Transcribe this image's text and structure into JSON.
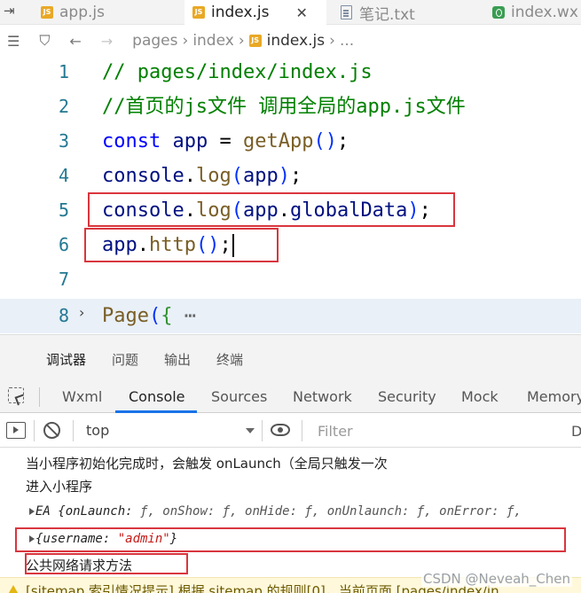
{
  "tabs": [
    {
      "label": "app.js",
      "icon": "js-icon",
      "active": false
    },
    {
      "label": "index.js",
      "icon": "js-icon",
      "active": true
    },
    {
      "label": "笔记.txt",
      "icon": "text-file-icon",
      "active": false
    },
    {
      "label": "index.wx",
      "icon": "wxml-icon",
      "active": false
    }
  ],
  "tab_close": "✕",
  "breadcrumb": {
    "items": [
      "pages",
      "index",
      "index.js",
      "..."
    ]
  },
  "editor": {
    "lines": [
      {
        "num": "1",
        "text": "// pages/index/index.js"
      },
      {
        "num": "2",
        "text": "//首页的js文件 调用全局的app.js文件"
      },
      {
        "num": "3",
        "text": "const app = getApp();"
      },
      {
        "num": "4",
        "text": "console.log(app);"
      },
      {
        "num": "5",
        "text": "console.log(app.globalData);"
      },
      {
        "num": "6",
        "text": "app.http();"
      },
      {
        "num": "7",
        "text": ""
      },
      {
        "num": "8",
        "text": "Page({ ⋯"
      }
    ]
  },
  "debug_panel_tabs": [
    "调试器",
    "问题",
    "输出",
    "终端"
  ],
  "devtools_tabs": [
    "Wxml",
    "Console",
    "Sources",
    "Network",
    "Security",
    "Mock",
    "Memory"
  ],
  "console_toolbar": {
    "context": "top",
    "filter_placeholder": "Filter",
    "trailing": "D"
  },
  "console_output": {
    "line1": "当小程序初始化完成时，会触发 onLaunch（全局只触发一次",
    "line2": "进入小程序",
    "line3_prefix": "EA {onLaunch: ",
    "line3_rest": "ƒ, onShow: ƒ, onHide: ƒ, onUnlaunch: ƒ, onError: ƒ,",
    "line4_key": "{username: ",
    "line4_value": "\"admin\"",
    "line4_close": "}",
    "line5": "公共网络请求方法",
    "warning": "[sitemap 索引情况提示] 根据 sitemap 的规则[0]，当前页面 [pages/index/in"
  },
  "watermark": "CSDN @Neveah_Chen"
}
